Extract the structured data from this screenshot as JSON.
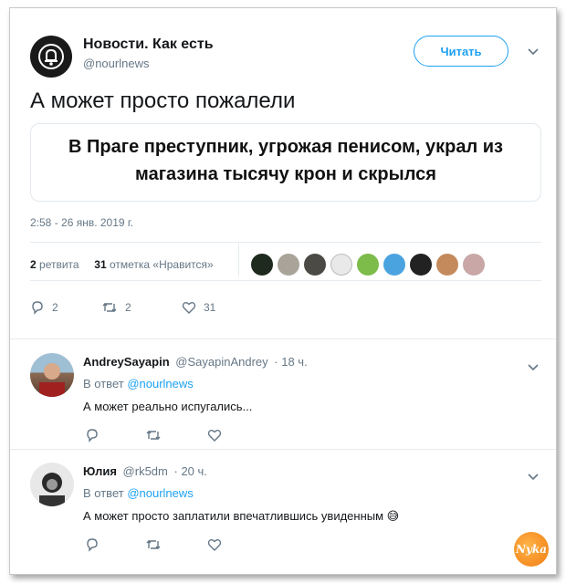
{
  "tweet": {
    "author_name": "Новости. Как есть",
    "author_handle": "@nourlnews",
    "follow_label": "Читать",
    "text": "А может просто пожалели",
    "card": {
      "small_text": "",
      "headline": "В Праге преступник, угрожая пенисом, украл из магазина тысячу крон и скрылся"
    },
    "timestamp": "2:58 - 26 янв. 2019 г.",
    "retweets_count": "2",
    "retweets_label": "ретвита",
    "likes_count": "31",
    "likes_label": "отметка «Нравится»",
    "actions": {
      "replies": "2",
      "retweets": "2",
      "likes": "31"
    }
  },
  "replies": [
    {
      "name": "AndreySayapin",
      "handle": "@SayapinAndrey",
      "time": "· 18 ч.",
      "in_reply_prefix": "В ответ",
      "in_reply_handle": "@nourlnews",
      "text": "А может реально испугались..."
    },
    {
      "name": "Юлия",
      "handle": "@rk5dm",
      "time": "· 20 ч.",
      "in_reply_prefix": "В ответ",
      "in_reply_handle": "@nourlnews",
      "text": "А может просто заплатили впечатлившись увиденным 😅"
    }
  ],
  "watermark": "Nyka",
  "colors": {
    "accent": "#1da1f2",
    "muted": "#657786",
    "text": "#14171a"
  }
}
